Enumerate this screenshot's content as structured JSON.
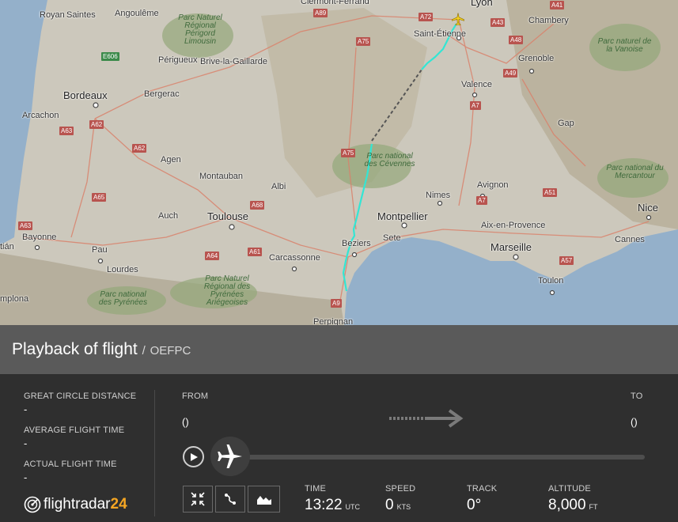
{
  "map": {
    "cities": [
      "Royan",
      "Saintes",
      "Angoulême",
      "Clermont-Ferrand",
      "Lyon",
      "Saint-Étienne",
      "Chambery",
      "Périgueux",
      "Brive-la-Gaillarde",
      "Grenoble",
      "Bordeaux",
      "Bergerac",
      "Valence",
      "Arcachon",
      "Gap",
      "Agen",
      "Montauban",
      "Albi",
      "Avignon",
      "Toulouse",
      "Nimes",
      "Montpellier",
      "Nice",
      "Bayonne",
      "Pau",
      "Auch",
      "Beziers",
      "Sete",
      "Aix-en-Provence",
      "Cannes",
      "Carcassonne",
      "Marseille",
      "Lourdes",
      "Toulon",
      "Perpignan",
      "tián",
      "mplona"
    ],
    "parks": [
      "Parc Naturel Régional Périgord Limousin",
      "Parc naturel de la Vanoise",
      "Parc national des Cévennes",
      "Parc national du Mercantour",
      "Parc Naturel Régional des Pyrénées Ariégeoises",
      "Parc national des Pyrénées"
    ],
    "roads": [
      "A89",
      "A72",
      "A41",
      "A43",
      "A48",
      "E606",
      "A75",
      "A49",
      "A7",
      "A63",
      "A62",
      "A62",
      "A75",
      "A65",
      "A68",
      "A51",
      "A7",
      "A63",
      "A64",
      "A61",
      "A57",
      "A9"
    ]
  },
  "header": {
    "title": "Playback of flight",
    "separator": "/",
    "flight_id": "OEFPC"
  },
  "stats": {
    "great_circle_label": "GREAT CIRCLE DISTANCE",
    "great_circle_value": "-",
    "avg_time_label": "AVERAGE FLIGHT TIME",
    "avg_time_value": "-",
    "actual_time_label": "ACTUAL FLIGHT TIME",
    "actual_time_value": "-"
  },
  "route": {
    "from_label": "FROM",
    "from_value": "()",
    "to_label": "TO",
    "to_value": "()"
  },
  "playback": {
    "progress": 0
  },
  "telemetry": {
    "time_label": "TIME",
    "time_value": "13:22",
    "time_unit": "UTC",
    "speed_label": "SPEED",
    "speed_value": "0",
    "speed_unit": "KTS",
    "track_label": "TRACK",
    "track_value": "0°",
    "altitude_label": "ALTITUDE",
    "altitude_value": "8,000",
    "altitude_unit": "FT"
  },
  "brand": {
    "name_part1": "flightradar",
    "name_part2": "24"
  },
  "colors": {
    "track": "#33e6d4",
    "aircraft": "#f5d21f",
    "brand_accent": "#f5a623",
    "title_bar": "#5a5a5a",
    "panel": "#2f2f2f",
    "sea": "#a8c8e8"
  }
}
